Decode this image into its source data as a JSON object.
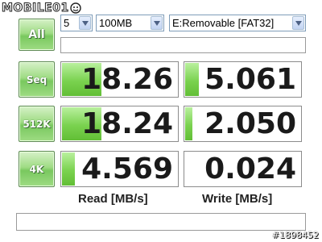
{
  "logo": {
    "text": "MOBILE01"
  },
  "controls": {
    "all_label": "All",
    "runs_value": "5",
    "size_value": "100MB",
    "drive_value": "E:Removable [FAT32]"
  },
  "tests": [
    {
      "label": "Seq",
      "read": "18.26",
      "write": "5.061",
      "read_fill": 0.34,
      "write_fill": 0.12
    },
    {
      "label": "512K",
      "read": "18.24",
      "write": "2.050",
      "read_fill": 0.34,
      "write_fill": 0.06
    },
    {
      "label": "4K",
      "read": "4.569",
      "write": "0.024",
      "read_fill": 0.11,
      "write_fill": 0.0
    }
  ],
  "columns": {
    "read_label": "Read [MB/s]",
    "write_label": "Write [MB/s]"
  },
  "watermark": "#1898452",
  "colors": {
    "accent_green": "#79c85e",
    "bar_green": "#62be36"
  }
}
